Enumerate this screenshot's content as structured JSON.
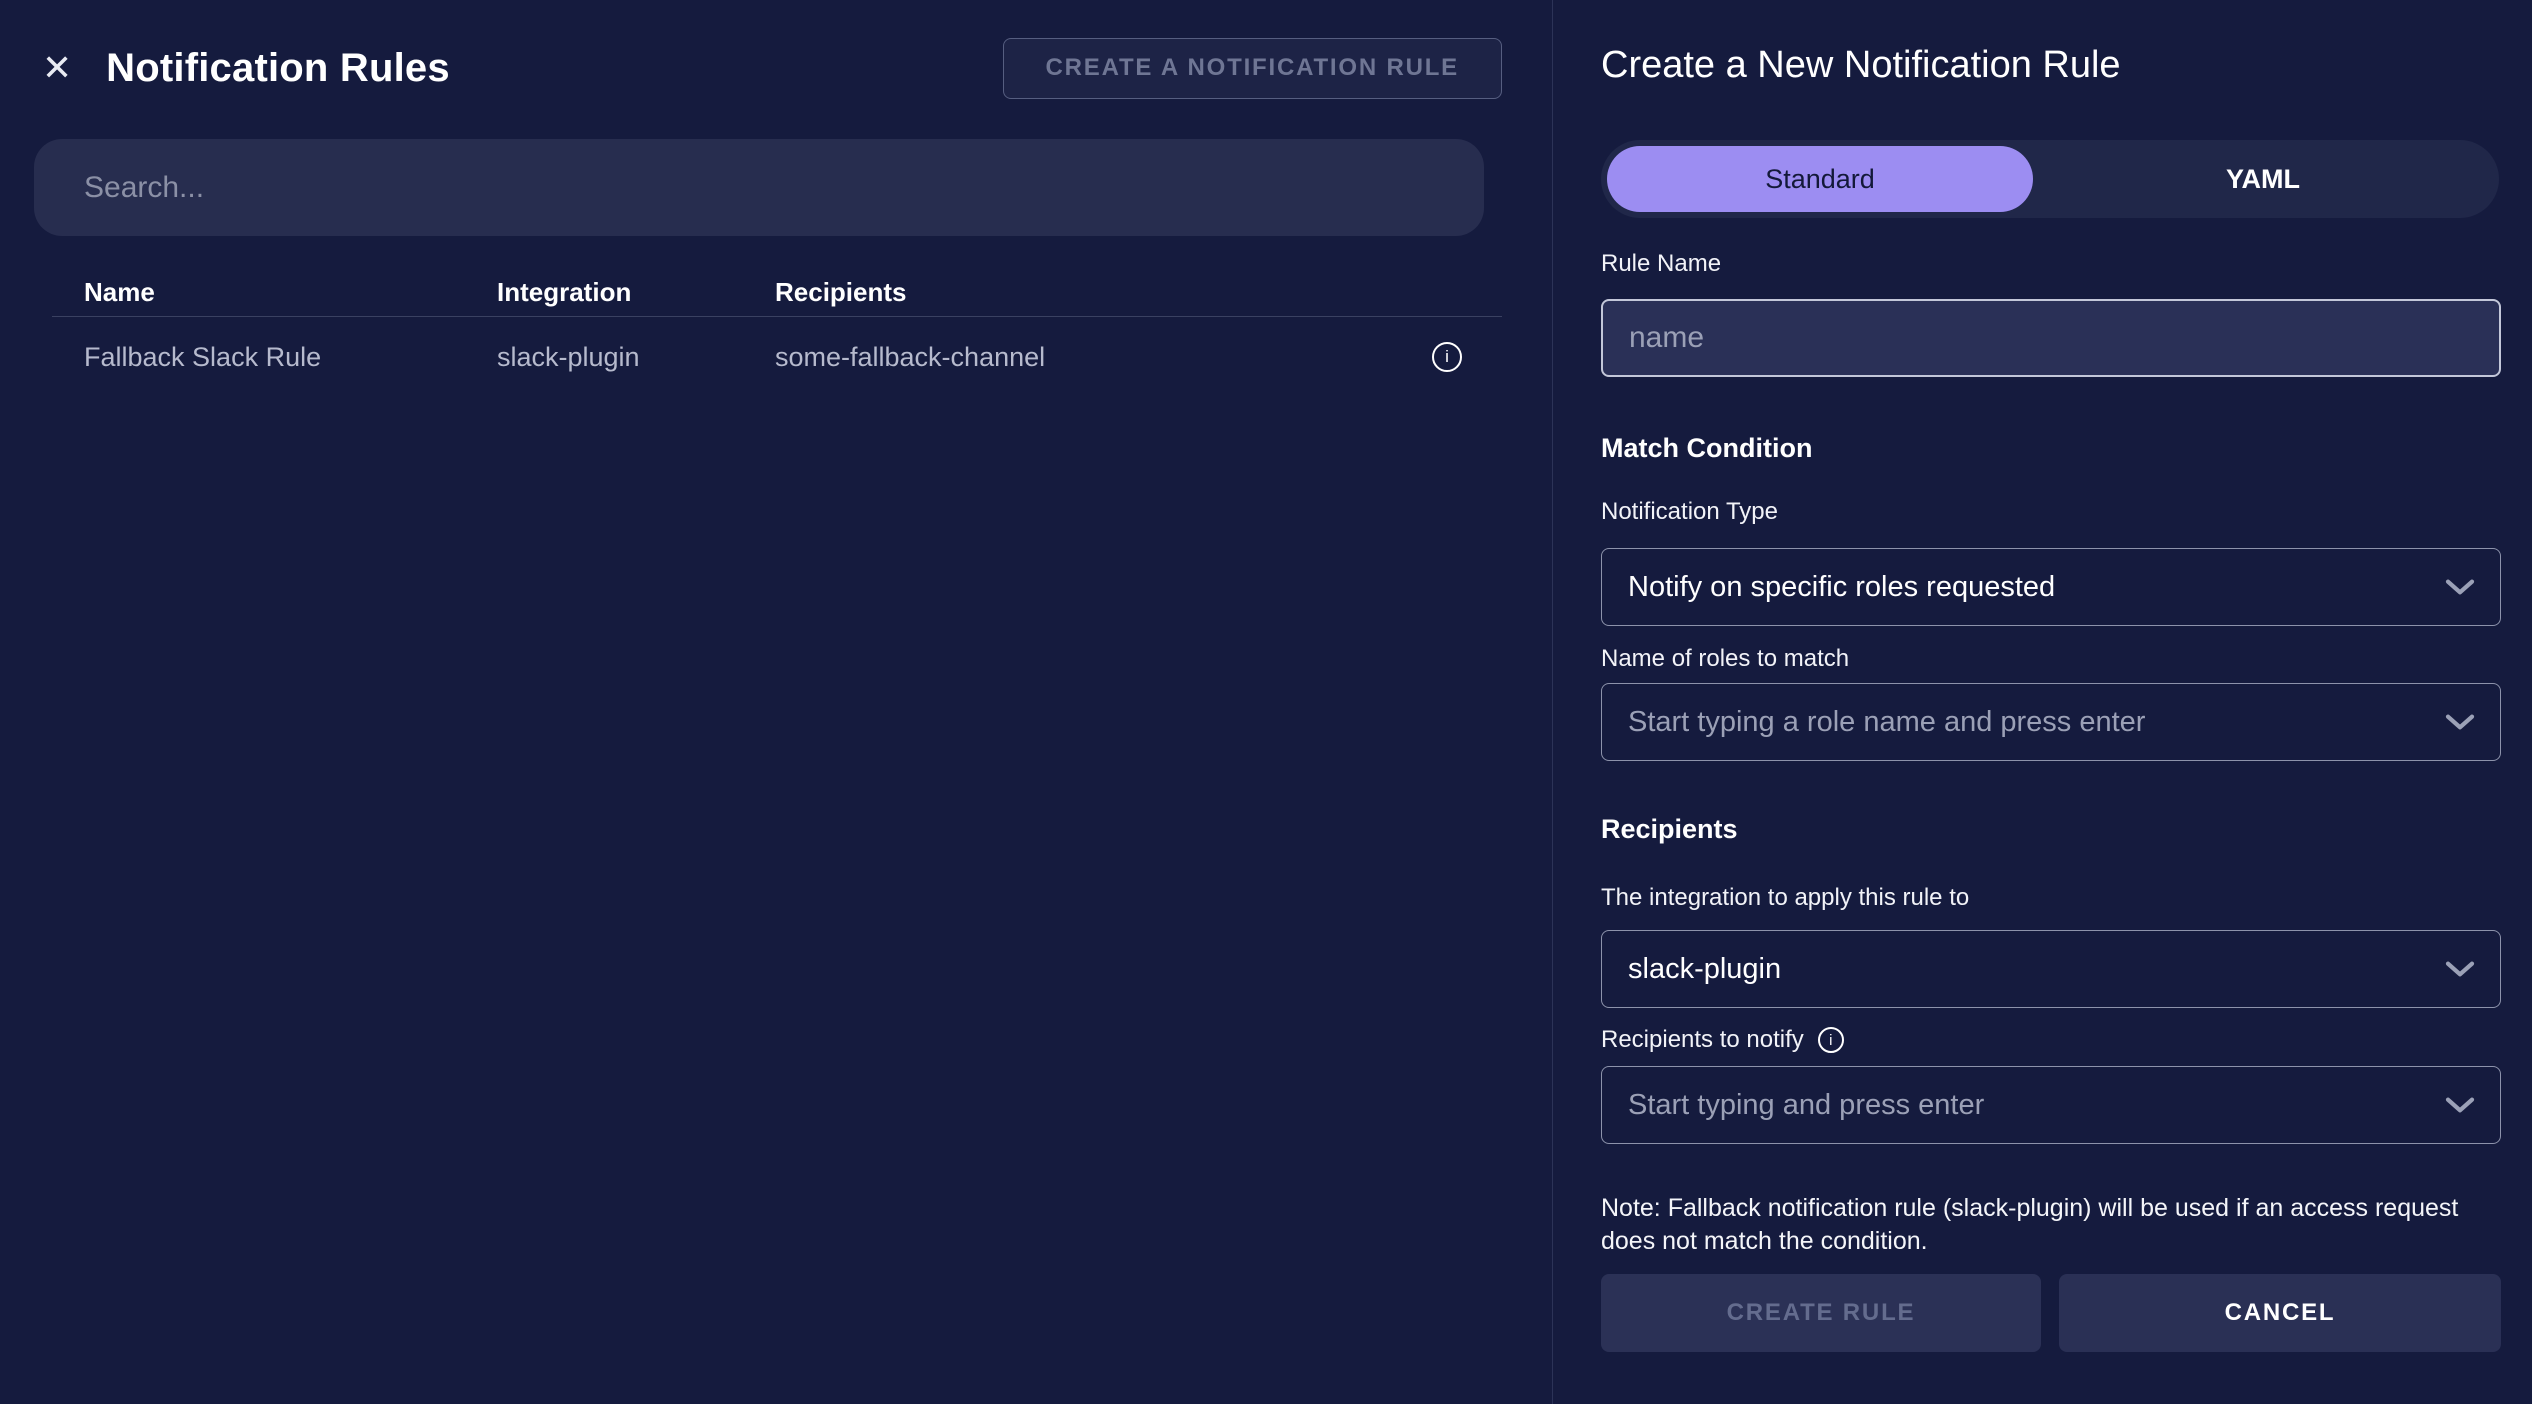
{
  "colors": {
    "background": "#151b3e",
    "accent_purple": "#9c8df2",
    "panel_divider": "#2c3357",
    "input_background": "#2a3057",
    "muted_text": "#9ba0b6",
    "disabled_text": "#646c8e"
  },
  "icons": {
    "close": "✕",
    "info": "i"
  },
  "left_panel": {
    "title": "Notification Rules",
    "create_button_label": "CREATE A NOTIFICATION RULE",
    "search_placeholder": "Search...",
    "table": {
      "columns": {
        "name": "Name",
        "integration": "Integration",
        "recipients": "Recipients"
      },
      "rows": [
        {
          "name": "Fallback Slack Rule",
          "integration": "slack-plugin",
          "recipients": "some-fallback-channel"
        }
      ]
    }
  },
  "right_panel": {
    "title": "Create a New Notification Rule",
    "tabs": [
      {
        "label": "Standard",
        "active": true
      },
      {
        "label": "YAML",
        "active": false
      }
    ],
    "rule_name": {
      "label": "Rule Name",
      "placeholder": "name"
    },
    "match_condition": {
      "heading": "Match Condition",
      "notification_type": {
        "label": "Notification Type",
        "value": "Notify on specific roles requested"
      },
      "roles": {
        "label": "Name of roles to match",
        "placeholder": "Start typing a role name and press enter"
      }
    },
    "recipients": {
      "heading": "Recipients",
      "integration": {
        "label": "The integration to apply this rule to",
        "value": "slack-plugin"
      },
      "notify": {
        "label": "Recipients to notify",
        "placeholder": "Start typing and press enter"
      }
    },
    "note": "Note: Fallback notification rule (slack-plugin) will be used if an access request does not match the condition.",
    "create_button_label": "CREATE RULE",
    "cancel_button_label": "CANCEL"
  }
}
